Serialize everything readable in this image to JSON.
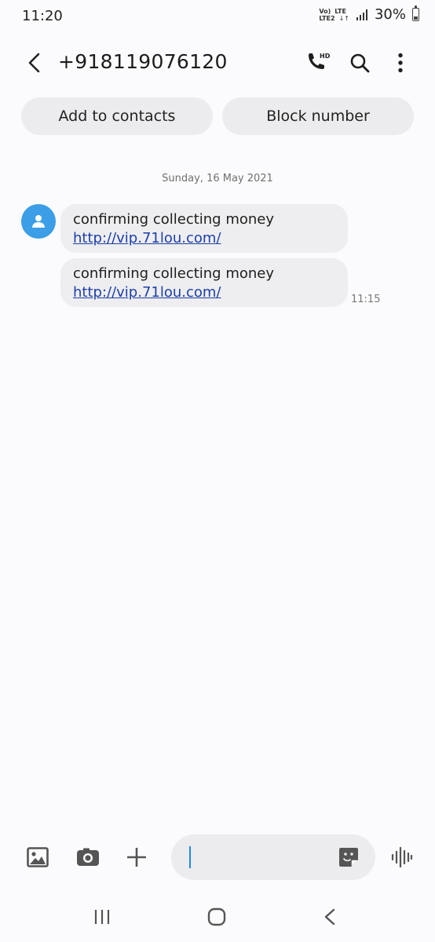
{
  "status_bar": {
    "time": "11:20",
    "network_top_left": "Vo)",
    "network_top_right": "LTE",
    "network_bottom_left": "LTE2",
    "battery_percent": "30%",
    "battery_level": 0.3
  },
  "header": {
    "title": "+918119076120",
    "icons": [
      "back-icon",
      "hd-call-icon",
      "search-icon",
      "more-options-icon"
    ]
  },
  "actions": {
    "add_contact_label": "Add to contacts",
    "block_label": "Block number"
  },
  "conversation": {
    "date": "Sunday, 16 May 2021",
    "messages": [
      {
        "text": "confirming collecting money",
        "link": "http://vip.71lou.com/"
      },
      {
        "text": "confirming collecting money",
        "link": "http://vip.71lou.com/",
        "time": "11:15"
      }
    ]
  },
  "composer": {
    "placeholder": "",
    "value": "",
    "icons": [
      "gallery-icon",
      "camera-icon",
      "add-icon",
      "sticker-icon",
      "voice-icon"
    ]
  },
  "nav_bar": {
    "icons": [
      "recent-apps-icon",
      "home-icon",
      "back-nav-icon"
    ]
  },
  "colors": {
    "background": "#fbfbfd",
    "bubble": "#eeeef0",
    "link": "#1c3fa8",
    "avatar": "#3b9ee6",
    "caret": "#1e88e5"
  }
}
